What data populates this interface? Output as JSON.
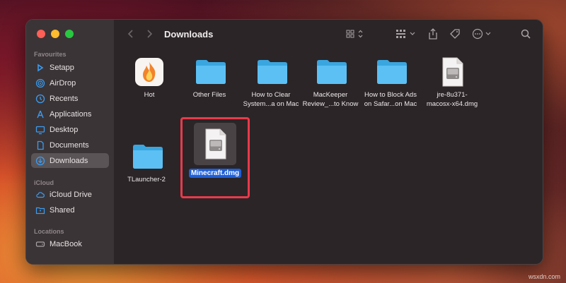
{
  "window": {
    "title": "Downloads"
  },
  "sidebar": {
    "sections": [
      {
        "heading": "Favourites",
        "items": [
          {
            "label": "Setapp",
            "icon": "setapp-icon"
          },
          {
            "label": "AirDrop",
            "icon": "airdrop-icon"
          },
          {
            "label": "Recents",
            "icon": "clock-icon"
          },
          {
            "label": "Applications",
            "icon": "applications-icon"
          },
          {
            "label": "Desktop",
            "icon": "desktop-icon"
          },
          {
            "label": "Documents",
            "icon": "document-icon"
          },
          {
            "label": "Downloads",
            "icon": "download-icon",
            "active": true
          }
        ]
      },
      {
        "heading": "iCloud",
        "items": [
          {
            "label": "iCloud Drive",
            "icon": "cloud-icon"
          },
          {
            "label": "Shared",
            "icon": "shared-folder-icon"
          }
        ]
      },
      {
        "heading": "Locations",
        "items": [
          {
            "label": "MacBook",
            "icon": "drive-icon"
          }
        ]
      }
    ]
  },
  "files": [
    {
      "name_line1": "Hot",
      "name_line2": "",
      "kind": "app"
    },
    {
      "name_line1": "Other Files",
      "name_line2": "",
      "kind": "folder"
    },
    {
      "name_line1": "How to Clear",
      "name_line2": "System...a on Mac",
      "kind": "folder"
    },
    {
      "name_line1": "MacKeeper",
      "name_line2": "Review_...to Know",
      "kind": "folder"
    },
    {
      "name_line1": "How to Block Ads",
      "name_line2": "on Safar...on Mac",
      "kind": "folder"
    },
    {
      "name_line1": "jre-8u371-",
      "name_line2": "macosx-x64.dmg",
      "kind": "dmg"
    },
    {
      "name_line1": "TLauncher-2",
      "name_line2": "",
      "kind": "folder"
    },
    {
      "name_line1": "Minecraft.dmg",
      "name_line2": "",
      "kind": "dmg",
      "selected": true
    }
  ],
  "colors": {
    "folder": "#4db8f0",
    "selection": "#1f5fd8",
    "highlight_box": "#e83a4a"
  },
  "watermark": "wsxdn.com"
}
